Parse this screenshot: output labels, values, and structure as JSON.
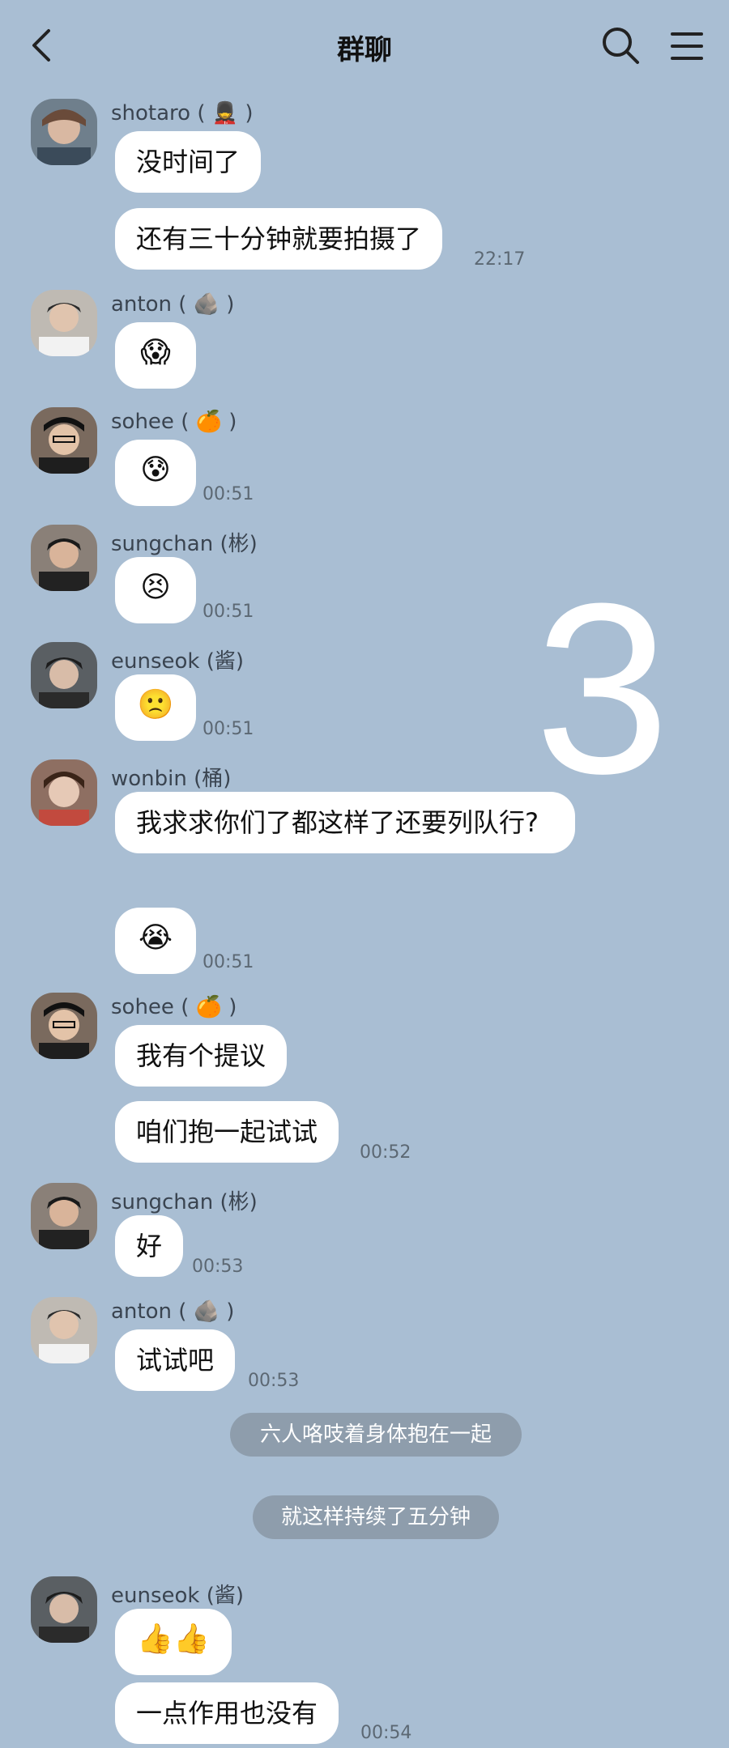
{
  "header": {
    "title": "群聊"
  },
  "overlay_number": "3",
  "messages": [
    {
      "sender": "shotaro ( 💂 )",
      "bubble": "没时间了"
    },
    {
      "bubble": "还有三十分钟就要拍摄了",
      "time": "22:17"
    },
    {
      "sender": "anton ( 🪨 )",
      "bubble": "😱"
    },
    {
      "sender": "sohee ( 🍊 )",
      "bubble": "😰",
      "time": "00:51"
    },
    {
      "sender": "sungchan (彬)",
      "bubble": "😣",
      "time": "00:51"
    },
    {
      "sender": "eunseok (酱)",
      "bubble": "🙁",
      "time": "00:51"
    },
    {
      "sender": "wonbin (桶)",
      "bubble": "我求求你们了都这样了还要列队行?"
    },
    {
      "bubble": "😭",
      "time": "00:51"
    },
    {
      "sender": "sohee ( 🍊 )",
      "bubble": "我有个提议"
    },
    {
      "bubble": "咱们抱一起试试",
      "time": "00:52"
    },
    {
      "sender": "sungchan (彬)",
      "bubble": "好",
      "time": "00:53"
    },
    {
      "sender": "anton ( 🪨 )",
      "bubble": "试试吧",
      "time": "00:53"
    },
    {
      "sender": "eunseok (酱)",
      "bubble": "👍👍"
    },
    {
      "bubble": "一点作用也没有",
      "time": "00:54"
    }
  ],
  "system_messages": [
    "六人咯吱着身体抱在一起",
    "就这样持续了五分钟"
  ],
  "colors": {
    "background": "#a9bed3",
    "bubble": "#ffffff",
    "system_pill": "#8e9dac"
  }
}
